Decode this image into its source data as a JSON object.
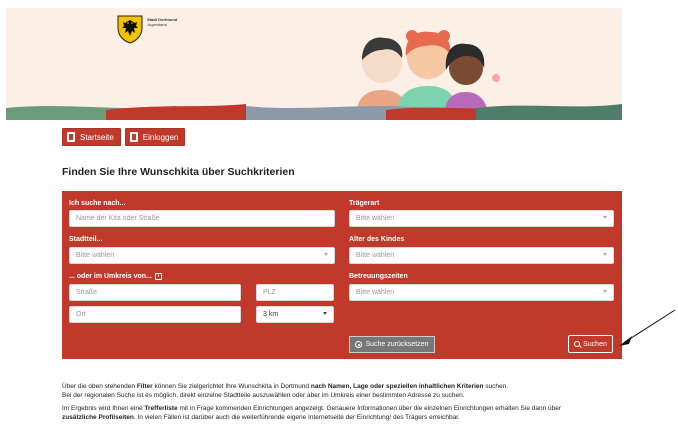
{
  "header": {
    "logo_line1": "Stadt Dortmund",
    "logo_line2": "Jugendamt"
  },
  "nav": {
    "home_label": "Startseite",
    "login_label": "Einloggen"
  },
  "page_title": "Finden Sie Ihre Wunschkita über Suchkriterien",
  "search": {
    "search_label": "Ich suche nach...",
    "search_placeholder": "Name der Kita oder Straße",
    "district_label": "Stadtteil...",
    "district_value": "Bitte wählen",
    "radius_label": "... oder im Umkreis von...",
    "radius_info": "i",
    "street_placeholder": "Straße",
    "zip_placeholder": "PLZ",
    "city_placeholder": "Ort",
    "radius_value": "3 km",
    "provider_label": "Trägerart",
    "provider_value": "Bitte wählen",
    "age_label": "Alter des Kindes",
    "age_value": "Bitte wählen",
    "hours_label": "Betreuungszeiten",
    "hours_value": "Bitte wählen",
    "reset_label": "Suche zurücksetzen",
    "submit_label": "Suchen"
  },
  "description": {
    "p1_a": "Über die oben stehenden ",
    "p1_b": "Filter",
    "p1_c": " können Sie zielgerichtet Ihre Wunschkita in Dortmund ",
    "p1_d": "nach Namen, Lage oder speziellen inhaltlichen Kriterien",
    "p1_e": " suchen.",
    "p1_line2": "Bei der regionalen Suche ist es möglich, direkt einzelne Stadtteile auszuwählen oder aber im Umkreis einer bestimmten Adresse zu suchen.",
    "p2_a": "Im Ergebnis wird Ihnen eine ",
    "p2_b": "Trefferliste",
    "p2_c": " mit in Frage kommenden Einrichtungen angezeigt. Genauere Informationen über die einzelnen Einrichtungen erhalten Sie dann über",
    "p2_d": "zusätzliche Profilseiten",
    "p2_e": ". In vielen Fällen ist darüber auch die weiterführende eigene Internetseite der Einrichtung/ des Trägers erreichbar."
  },
  "colors": {
    "accent": "#c0392b",
    "banner_bg": "#fcefe6",
    "reset_bg": "#777777"
  }
}
